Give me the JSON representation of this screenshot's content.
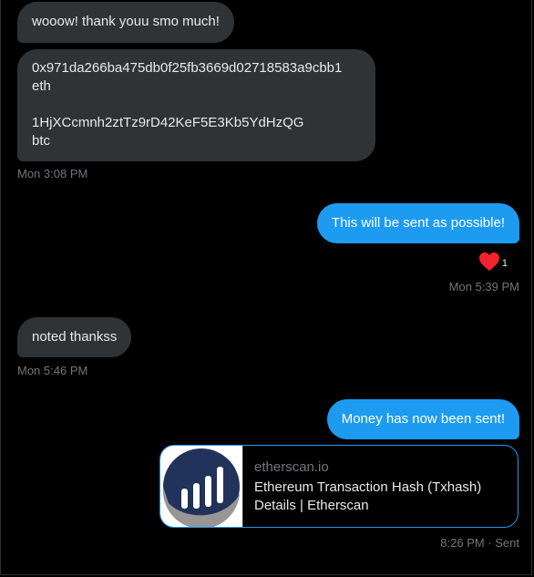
{
  "conversation": {
    "messages": [
      {
        "text": "wooow! thank youu smo much!"
      },
      {
        "lines": [
          "0x971da266ba475db0f25fb3669d02718583a9cbb1",
          "eth",
          "1HjXCcmnh2ztTz9rD42KeF5E3Kb5YdHzQG",
          "btc"
        ]
      },
      {
        "text": "This will be sent as possible!"
      },
      {
        "text": "noted thankss"
      },
      {
        "text": "Money has now been sent!"
      }
    ],
    "timestamps": [
      "Mon 3:08 PM",
      "Mon 5:39 PM",
      "Mon 5:46 PM",
      "8:26 PM · Sent"
    ],
    "reaction": {
      "icon": "heart-icon",
      "count": "1",
      "color": "#f91880"
    },
    "link_card": {
      "domain": "etherscan.io",
      "title_line1": "Ethereum Transaction Hash (Txhash)",
      "title_line2": "Details | Etherscan",
      "logo_icon": "etherscan-logo-icon"
    },
    "colors": {
      "background": "#000000",
      "incoming_bubble": "#2f3336",
      "outgoing_bubble": "#1d9bf0",
      "timestamp": "#71767b",
      "etherscan_navy": "#21325b",
      "etherscan_gray": "#979695"
    }
  }
}
